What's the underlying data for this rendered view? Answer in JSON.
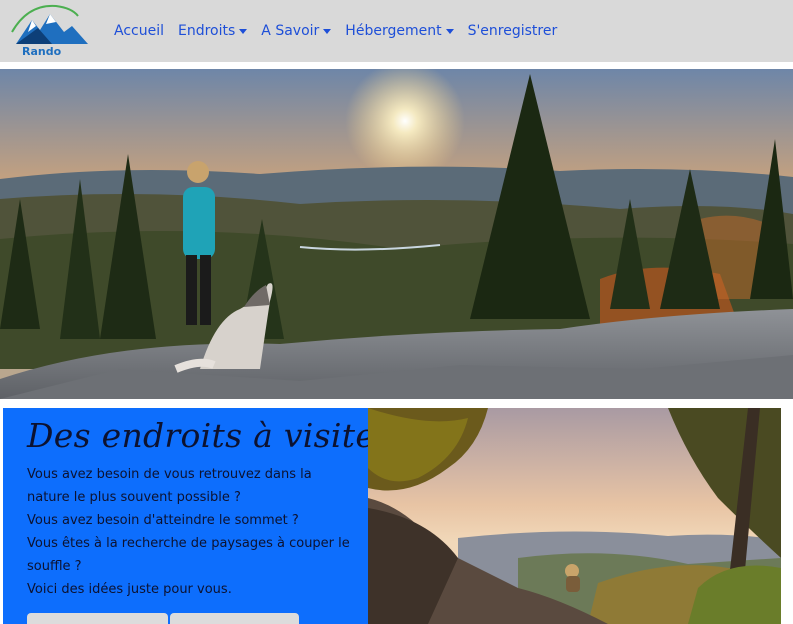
{
  "brand": {
    "logo_text": "Rando"
  },
  "nav": {
    "items": [
      {
        "label": "Accueil",
        "dropdown": false
      },
      {
        "label": "Endroits",
        "dropdown": true
      },
      {
        "label": "A Savoir",
        "dropdown": true
      },
      {
        "label": "Hébergement",
        "dropdown": true
      },
      {
        "label": "S'enregistrer",
        "dropdown": false
      }
    ]
  },
  "card": {
    "title": "Des endroits à visiter",
    "lines": [
      "Vous avez besoin de vous retrouvez dans la nature le plus souvent possible ?",
      "Vous avez besoin d'atteindre le sommet ?",
      "Vous êtes à la recherche de paysages à couper le souffle ?",
      "Voici des idées juste pour vous."
    ]
  },
  "colors": {
    "navbar_bg": "#d9d9d9",
    "link": "#1e4fd8",
    "card_bg": "#0d6efd",
    "card_text": "#0c1230"
  }
}
